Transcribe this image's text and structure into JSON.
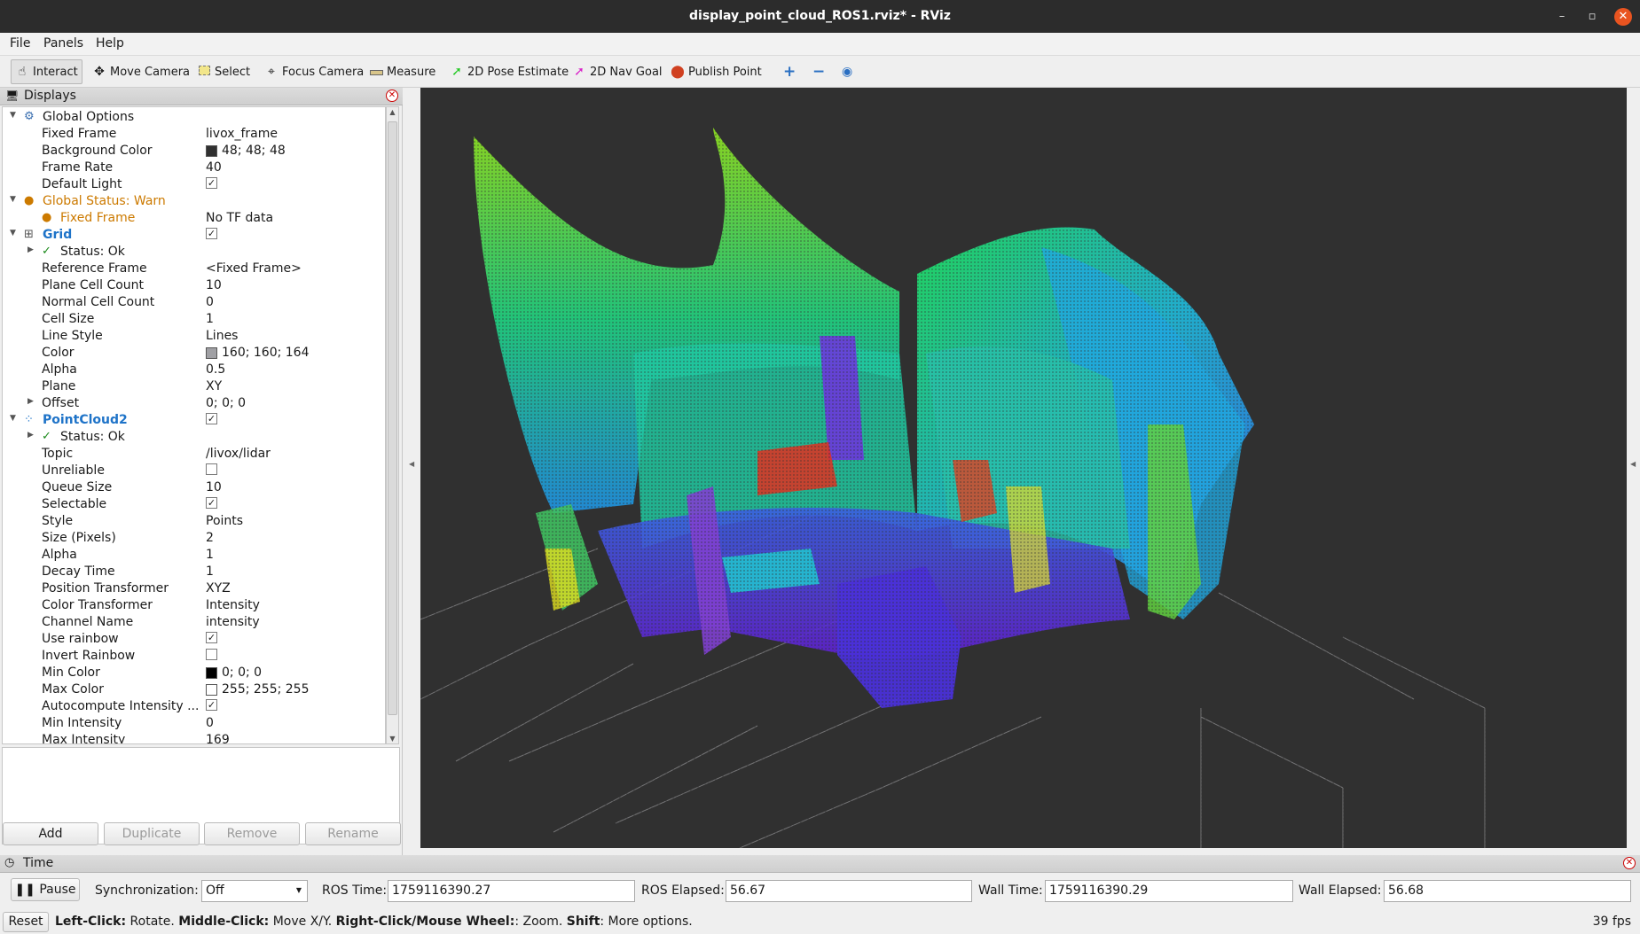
{
  "window": {
    "title": "display_point_cloud_ROS1.rviz* - RViz",
    "buttons": {
      "minimize": "–",
      "maximize": "▫",
      "close": "✕"
    }
  },
  "menu": [
    "File",
    "Panels",
    "Help"
  ],
  "toolbar": {
    "interact": "Interact",
    "move_camera": "Move Camera",
    "select": "Select",
    "focus_camera": "Focus Camera",
    "measure": "Measure",
    "pose_estimate": "2D Pose Estimate",
    "nav_goal": "2D Nav Goal",
    "publish_point": "Publish Point"
  },
  "displays": {
    "title": "Displays",
    "rows": [
      {
        "label": "Global Options",
        "value": ""
      },
      {
        "label": "Fixed Frame",
        "value": "livox_frame"
      },
      {
        "label": "Background Color",
        "value": "48; 48; 48",
        "swatch": "#303030"
      },
      {
        "label": "Frame Rate",
        "value": "40"
      },
      {
        "label": "Default Light",
        "check": "✓"
      },
      {
        "label": "Global Status: Warn",
        "value": ""
      },
      {
        "label": "Fixed Frame",
        "value": "No TF data"
      },
      {
        "label": "Grid",
        "check": "✓"
      },
      {
        "label": "Status: Ok",
        "value": ""
      },
      {
        "label": "Reference Frame",
        "value": "<Fixed Frame>"
      },
      {
        "label": "Plane Cell Count",
        "value": "10"
      },
      {
        "label": "Normal Cell Count",
        "value": "0"
      },
      {
        "label": "Cell Size",
        "value": "1"
      },
      {
        "label": "Line Style",
        "value": "Lines"
      },
      {
        "label": "Color",
        "value": "160; 160; 164",
        "swatch": "#a0a0a4"
      },
      {
        "label": "Alpha",
        "value": "0.5"
      },
      {
        "label": "Plane",
        "value": "XY"
      },
      {
        "label": "Offset",
        "value": "0; 0; 0"
      },
      {
        "label": "PointCloud2",
        "check": "✓"
      },
      {
        "label": "Status: Ok",
        "value": ""
      },
      {
        "label": "Topic",
        "value": "/livox/lidar"
      },
      {
        "label": "Unreliable",
        "check": ""
      },
      {
        "label": "Queue Size",
        "value": "10"
      },
      {
        "label": "Selectable",
        "check": "✓"
      },
      {
        "label": "Style",
        "value": "Points"
      },
      {
        "label": "Size (Pixels)",
        "value": "2"
      },
      {
        "label": "Alpha",
        "value": "1"
      },
      {
        "label": "Decay Time",
        "value": "1"
      },
      {
        "label": "Position Transformer",
        "value": "XYZ"
      },
      {
        "label": "Color Transformer",
        "value": "Intensity"
      },
      {
        "label": "Channel Name",
        "value": "intensity"
      },
      {
        "label": "Use rainbow",
        "check": "✓"
      },
      {
        "label": "Invert Rainbow",
        "check": ""
      },
      {
        "label": "Min Color",
        "value": "0; 0; 0",
        "swatch": "#000000"
      },
      {
        "label": "Max Color",
        "value": "255; 255; 255",
        "swatch": "#ffffff"
      },
      {
        "label": "Autocompute Intensity ...",
        "check": "✓"
      },
      {
        "label": "Min Intensity",
        "value": "0"
      },
      {
        "label": "Max Intensity",
        "value": "169"
      }
    ],
    "buttons": {
      "add": "Add",
      "duplicate": "Duplicate",
      "remove": "Remove",
      "rename": "Rename"
    }
  },
  "time": {
    "title": "Time",
    "pause": "Pause",
    "sync_label": "Synchronization:",
    "sync_value": "Off",
    "ros_time_label": "ROS Time:",
    "ros_time": "1759116390.27",
    "ros_elapsed_label": "ROS Elapsed:",
    "ros_elapsed": "56.67",
    "wall_time_label": "Wall Time:",
    "wall_time": "1759116390.29",
    "wall_elapsed_label": "Wall Elapsed:",
    "wall_elapsed": "56.68"
  },
  "status": {
    "reset": "Reset",
    "k1": "Left-Click:",
    "v1": " Rotate. ",
    "k2": "Middle-Click:",
    "v2": " Move X/Y. ",
    "k3": "Right-Click/Mouse Wheel:",
    "v3": ": Zoom. ",
    "k4": "Shift",
    "v4": ": More options.",
    "fps": "39 fps"
  },
  "colors": {
    "background": "#303030",
    "grid": "#a0a0a4",
    "warn": "#cc7a00",
    "accent": "#1e73c8"
  }
}
